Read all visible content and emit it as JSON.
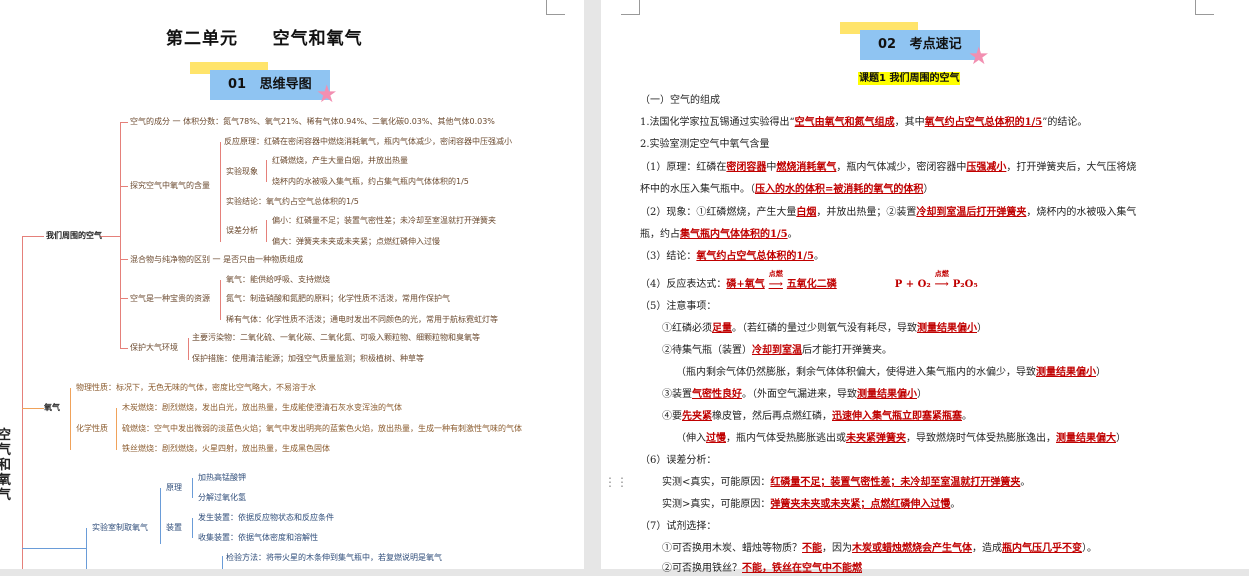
{
  "left": {
    "title": "第二单元     空气和氧气",
    "badge": {
      "num": "01",
      "label": "思维导图"
    },
    "vertical_title": "空气和氧气",
    "mindmap": {
      "n1": "我们周围的空气",
      "n1a": "空气的成分 一 体积分数：氮气78%、氧气21%、稀有气体0.94%、二氧化碳0.03%、其他气体0.03%",
      "n1b": "探究空气中氧气的含量",
      "n1b1": "反应原理：红磷在密闭容器中燃烧消耗氧气，瓶内气体减少，密闭容器中压强减小",
      "n1b2": "实验现象",
      "n1b2a": "红磷燃烧，产生大量白烟，并放出热量",
      "n1b2b": "烧杯内的水被吸入集气瓶，约占集气瓶内气体体积的1/5",
      "n1b3": "实验结论：氧气约占空气总体积的1/5",
      "n1b4": "误差分析",
      "n1b4a": "偏小：红磷量不足；装置气密性差；未冷却至室温就打开弹簧夹",
      "n1b4b": "偏大：弹簧夹未夹或未夹紧；点燃红磷伸入过慢",
      "n1c": "混合物与纯净物的区别 一 是否只由一种物质组成",
      "n1d": "空气是一种宝贵的资源",
      "n1d1": "氧气：能供给呼吸、支持燃烧",
      "n1d2": "氮气：制造硝酸和氮肥的原料；化学性质不活泼，常用作保护气",
      "n1d3": "稀有气体：化学性质不活泼；通电时发出不同颜色的光，常用于航标霓虹灯等",
      "n1e": "保护大气环境",
      "n1e1": "主要污染物：二氧化硫、一氧化碳、二氧化氮、可吸入颗粒物、细颗粒物和臭氧等",
      "n1e2": "保护措施：使用清洁能源；加强空气质量监测；积极植树、种草等",
      "n2": "氧气",
      "n2a": "物理性质：标况下，无色无味的气体，密度比空气略大，不易溶于水",
      "n2b": "化学性质",
      "n2b1": "木炭燃烧：剧烈燃烧，发出白光，放出热量，生成能使澄清石灰水变浑浊的气体",
      "n2b2": "硫燃烧：空气中发出微弱的淡蓝色火焰；氧气中发出明亮的蓝紫色火焰，放出热量，生成一种有刺激性气味的气体",
      "n2b3": "铁丝燃烧：剧烈燃烧，火星四射，放出热量，生成黑色固体",
      "n3": "实验室制取氧气",
      "n3a": "原理",
      "n3a1": "加热高锰酸钾",
      "n3a2": "分解过氧化氢",
      "n3b": "装置",
      "n3b1": "发生装置：依据反应物状态和反应条件",
      "n3b2": "收集装置：依据气体密度和溶解性",
      "n3c1": "检验方法：将带火星的木条伸到集气瓶中，若复燃说明是氧气"
    }
  },
  "right": {
    "badge": {
      "num": "02",
      "label": "考点速记"
    },
    "subhead": "课题1   我们周围的空气",
    "lines": {
      "s1": "（一）空气的组成",
      "l1a": "1.法国化学家拉瓦锡通过实验得出“",
      "l1b": "空气由氧气和氮气组成",
      "l1c": "，其中",
      "l1d": "氧气约占空气总体积的1/5",
      "l1e": "”的结论。",
      "l2": "2.实验室测定空气中氧气含量",
      "l3a": "（1）原理：红磷在",
      "l3b": "密闭容器",
      "l3c": "中",
      "l3d": "燃烧消耗氧气",
      "l3e": "，瓶内气体减少，密闭容器中",
      "l3f": "压强减小",
      "l3g": "，打开弹簧夹后，大气压将烧",
      "l4a": "杯中的水压入集气瓶中。（",
      "l4b": "压入的水的体积=被消耗的氧气的体积",
      "l4c": "）",
      "l5a": "（2）现象：①红磷燃烧，产生大量",
      "l5b": "白烟",
      "l5c": "，并放出热量；②装置",
      "l5d": "冷却到室温后打开弹簧夹",
      "l5e": "，烧杯内的水被吸入集气",
      "l6a": "瓶，约占",
      "l6b": "集气瓶内气体体积的1/5",
      "l6c": "。",
      "l7a": "（3）结论：",
      "l7b": "氧气约占空气总体积的1/5",
      "l7c": "。",
      "l8a": "（4）反应表达式：",
      "l8b": "磷+氧气",
      "l8cond": "点燃",
      "l8c": "五氧化二磷",
      "l8d": "P + O₂",
      "l8e": "P₂O₅",
      "l9": "（5）注意事项：",
      "l10a": "①红磷必须",
      "l10b": "足量",
      "l10c": "。（若红磷的量过少则氧气没有耗尽，导致",
      "l10d": "测量结果偏小",
      "l10e": "）",
      "l11a": "②待集气瓶（装置）",
      "l11b": "冷却到室温",
      "l11c": "后才能打开弹簧夹。",
      "l12a": "（瓶内剩余气体仍然膨胀，剩余气体体积偏大，使得进入集气瓶内的水偏少，导致",
      "l12b": "测量结果偏小",
      "l12c": "）",
      "l13a": "③装置",
      "l13b": "气密性良好",
      "l13c": "。（外面空气漏进来，导致",
      "l13d": "测量结果偏小",
      "l13e": "）",
      "l14a": "④要",
      "l14b": "先夹紧",
      "l14c": "橡皮管，然后再点燃红磷，",
      "l14d": "迅速伸入集气瓶立即塞紧瓶塞",
      "l14e": "。",
      "l15a": "（伸入",
      "l15b": "过慢",
      "l15c": "，瓶内气体受热膨胀逃出或",
      "l15d": "未夹紧弹簧夹",
      "l15e": "，导致燃烧时气体受热膨胀逸出，",
      "l15f": "测量结果偏大",
      "l15g": "）",
      "l16": "（6）误差分析：",
      "l17a": "实测<真实，可能原因：",
      "l17b": "红磷量不足；装置气密性差；未冷却至室温就打开弹簧夹",
      "l17c": "。",
      "l18a": "实测>真实，可能原因：",
      "l18b": "弹簧夹未夹或未夹紧；点燃红磷伸入过慢",
      "l18c": "。",
      "l19": "（7）试剂选择：",
      "l20a": "①可否换用木炭、蜡烛等物质？",
      "l20b": "不能",
      "l20c": "，因为",
      "l20d": "木炭或蜡烛燃烧会产生气体",
      "l20e": "，造成",
      "l20f": "瓶内气压几乎不变",
      "l20g": "）。",
      "l21a": "②可否换用铁丝？",
      "l21b": "不能",
      "l21c": "，铁丝在空气中不能燃"
    }
  },
  "colors": {
    "accent_red": "#c00000",
    "badge_blue": "#8fc4f2",
    "badge_yellow": "#ffe46b",
    "star_pink": "#f28fb1",
    "highlight": "#ffff00"
  }
}
